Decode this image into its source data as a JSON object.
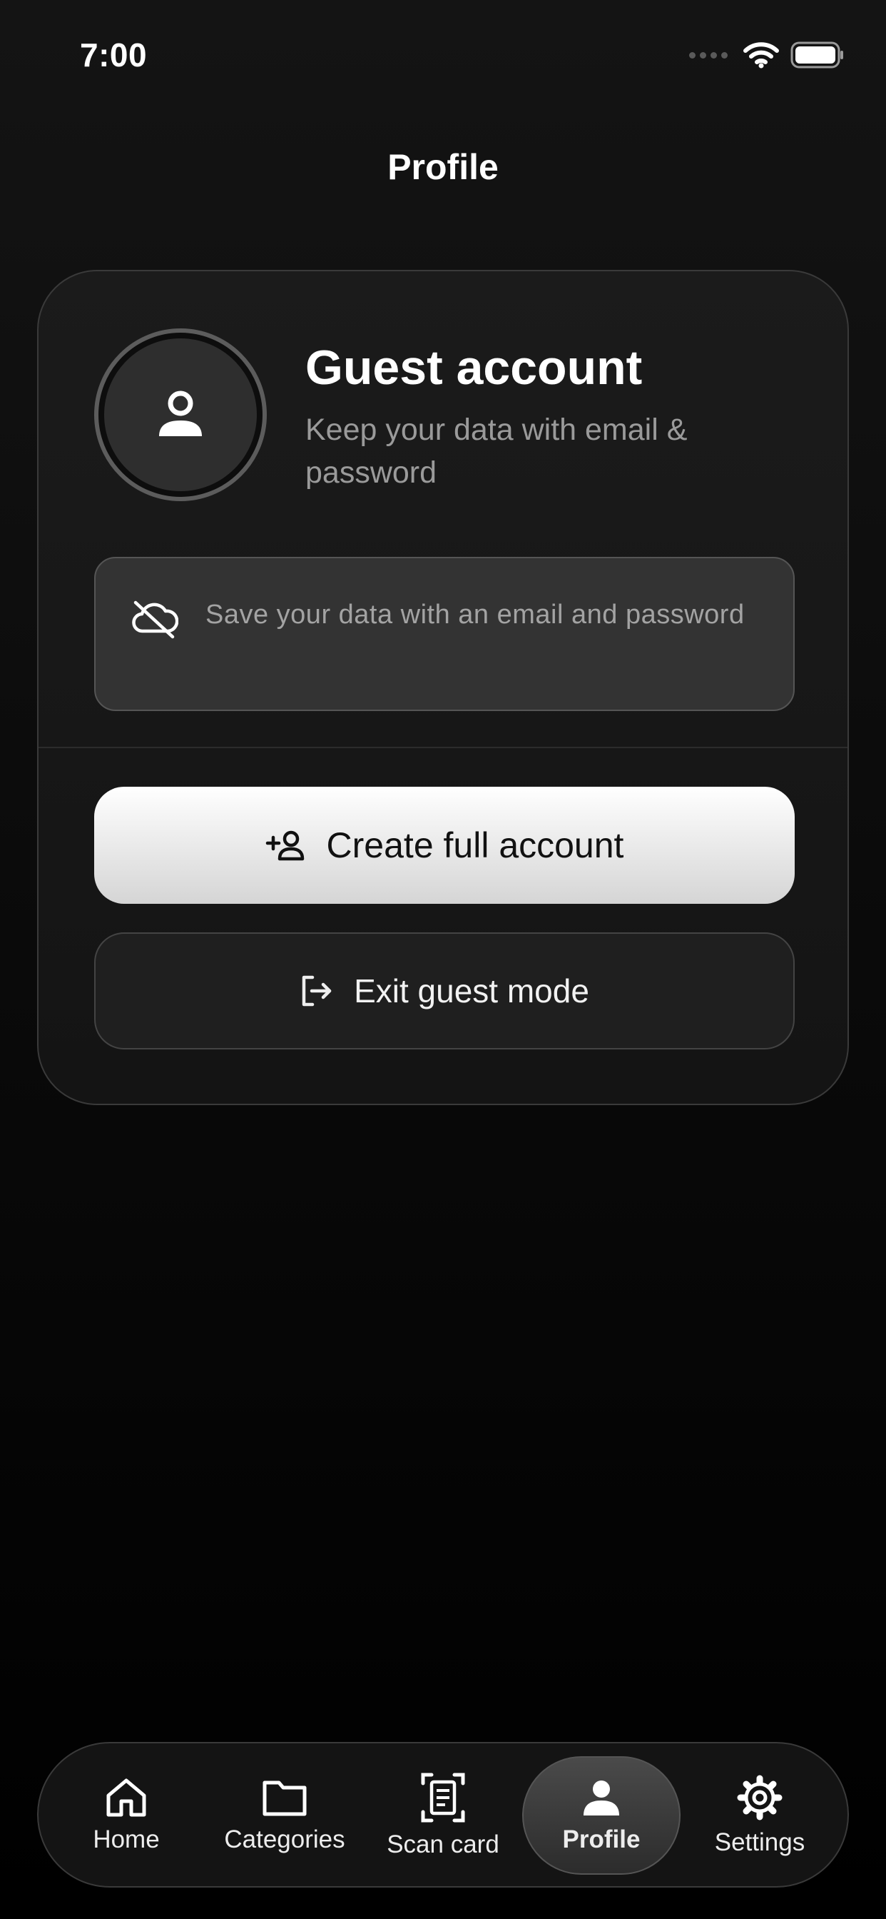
{
  "status_bar": {
    "time": "7:00"
  },
  "header": {
    "title": "Profile"
  },
  "profile_card": {
    "title": "Guest account",
    "subtitle": "Keep your data with email & password",
    "info_text": "Save your data with an email and password",
    "primary_action_label": "Create full account",
    "secondary_action_label": "Exit guest mode"
  },
  "icons": {
    "avatar": "person-icon",
    "info": "cloud-off-icon",
    "primary_action": "add-user-icon",
    "secondary_action": "logout-icon"
  },
  "tab_bar": {
    "active": "Profile",
    "tabs": [
      {
        "label": "Home",
        "icon": "home-icon"
      },
      {
        "label": "Categories",
        "icon": "folder-icon"
      },
      {
        "label": "Scan card",
        "icon": "scan-document-icon"
      },
      {
        "label": "Profile",
        "icon": "person-icon"
      },
      {
        "label": "Settings",
        "icon": "gear-icon"
      }
    ]
  }
}
